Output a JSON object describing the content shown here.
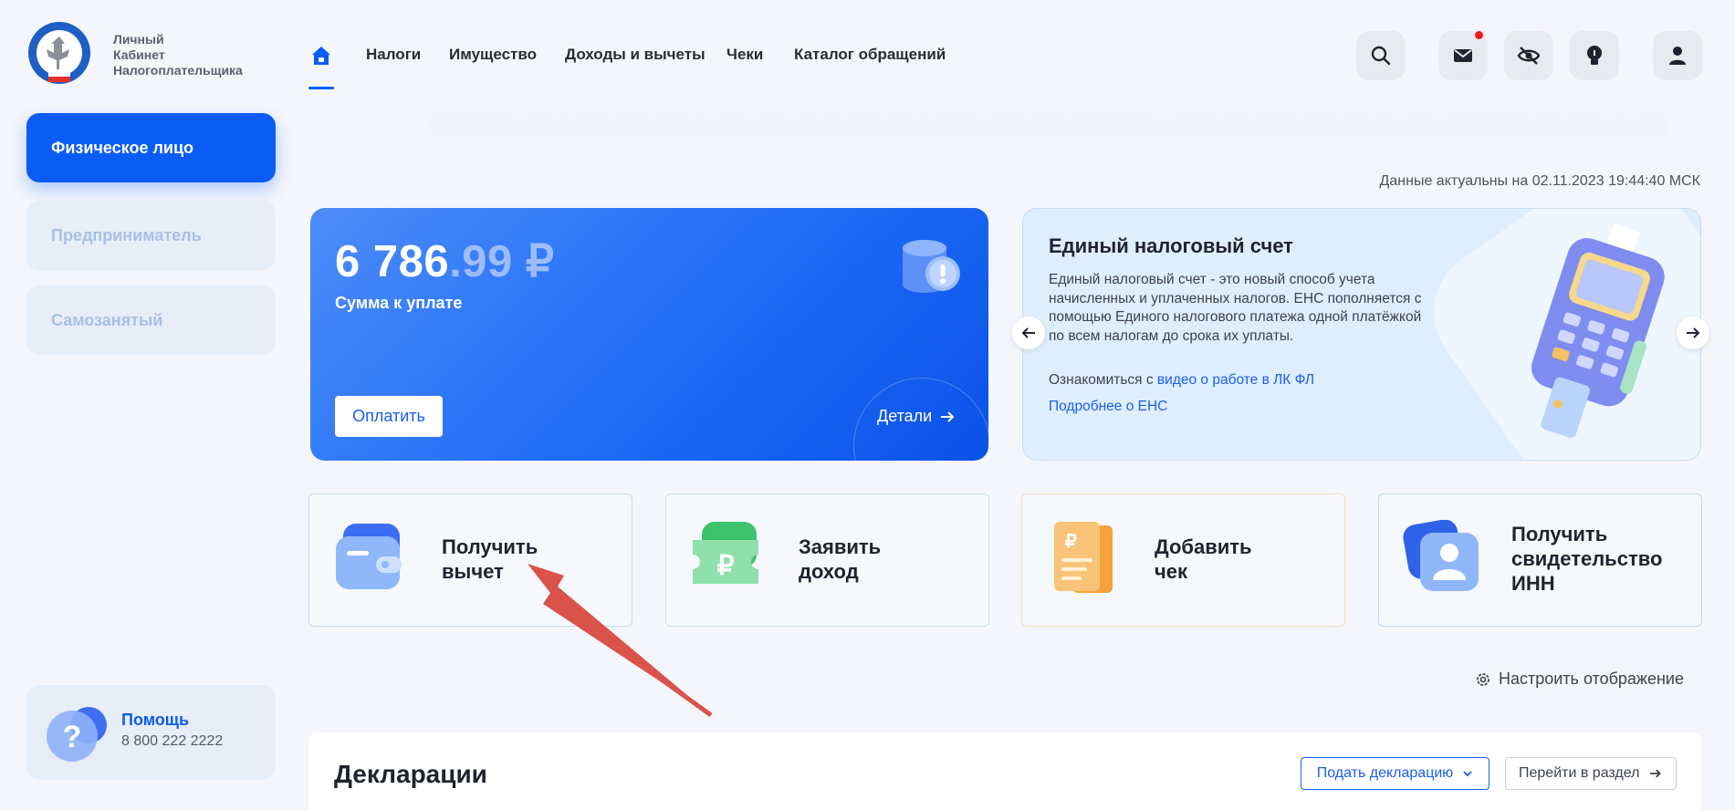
{
  "brand": {
    "lines": [
      "Личный",
      "Кабинет",
      "Налогоплательщика"
    ]
  },
  "sidebar": {
    "items": [
      {
        "label": "Физическое лицо"
      },
      {
        "label": "Предприниматель"
      },
      {
        "label": "Самозанятый"
      }
    ],
    "help": {
      "title": "Помощь",
      "phone": "8 800 222 2222"
    }
  },
  "nav": {
    "links": [
      "Налоги",
      "Имущество",
      "Доходы и вычеты",
      "Чеки",
      "Каталог обращений"
    ]
  },
  "header_icons": [
    "search-icon",
    "mail-icon",
    "eye-off-icon",
    "lightbulb-icon",
    "user-icon"
  ],
  "updated": "Данные актуальны на 02.11.2023 19:44:40 МСК",
  "balance": {
    "amount_int": "6 786",
    "amount_dec": ".99 ₽",
    "label": "Сумма к уплате",
    "pay_label": "Оплатить",
    "details_label": "Детали"
  },
  "ens": {
    "title": "Единый налоговый счет",
    "description": "Единый налоговый счет - это новый способ учета начисленных и уплаченных налогов. ЕНС пополняется с помощью Единого налогового платежа одной платёжкой по всем налогам до срока их уплаты.",
    "intro_prefix": "Ознакомиться с ",
    "intro_link": "видео о работе в ЛК ФЛ",
    "more_link": "Подробнее о ЕНС"
  },
  "tiles": [
    {
      "lines": [
        "Получить",
        "вычет"
      ]
    },
    {
      "lines": [
        "Заявить",
        "доход"
      ]
    },
    {
      "lines": [
        "Добавить",
        "чек"
      ]
    },
    {
      "lines": [
        "Получить",
        "свидетельство",
        "ИНН"
      ]
    }
  ],
  "settings_label": "Настроить отображение",
  "declarations": {
    "title": "Декларации",
    "submit_label": "Подать декларацию",
    "goto_label": "Перейти в раздел"
  },
  "colors": {
    "accent": "#0a5cf5",
    "annotation_arrow": "#d9534a",
    "notification": "#f21b1b"
  }
}
